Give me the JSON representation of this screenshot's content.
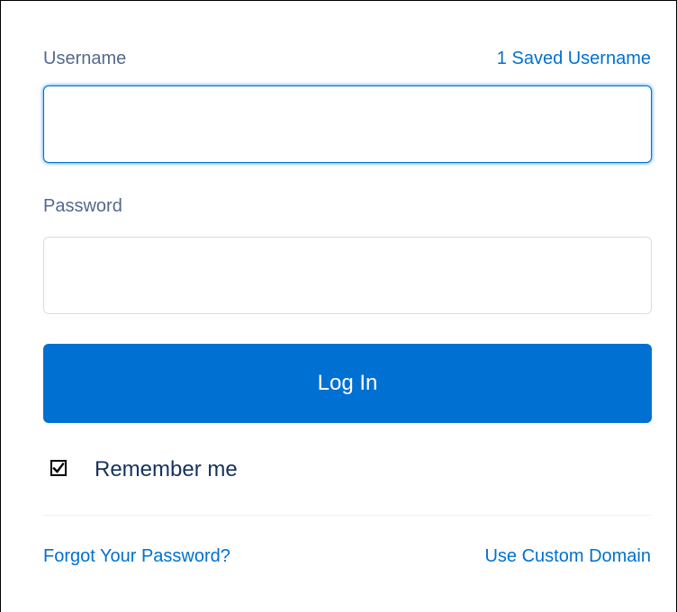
{
  "form": {
    "username_label": "Username",
    "saved_username_link": "1 Saved Username",
    "username_value": "",
    "password_label": "Password",
    "password_value": "",
    "login_button": "Log In",
    "remember_me_label": "Remember me",
    "remember_me_checked": true,
    "forgot_password_link": "Forgot Your Password?",
    "custom_domain_link": "Use Custom Domain"
  },
  "colors": {
    "brand_blue": "#0070d2",
    "label_gray": "#54698d",
    "field_border": "#d8dde6"
  }
}
